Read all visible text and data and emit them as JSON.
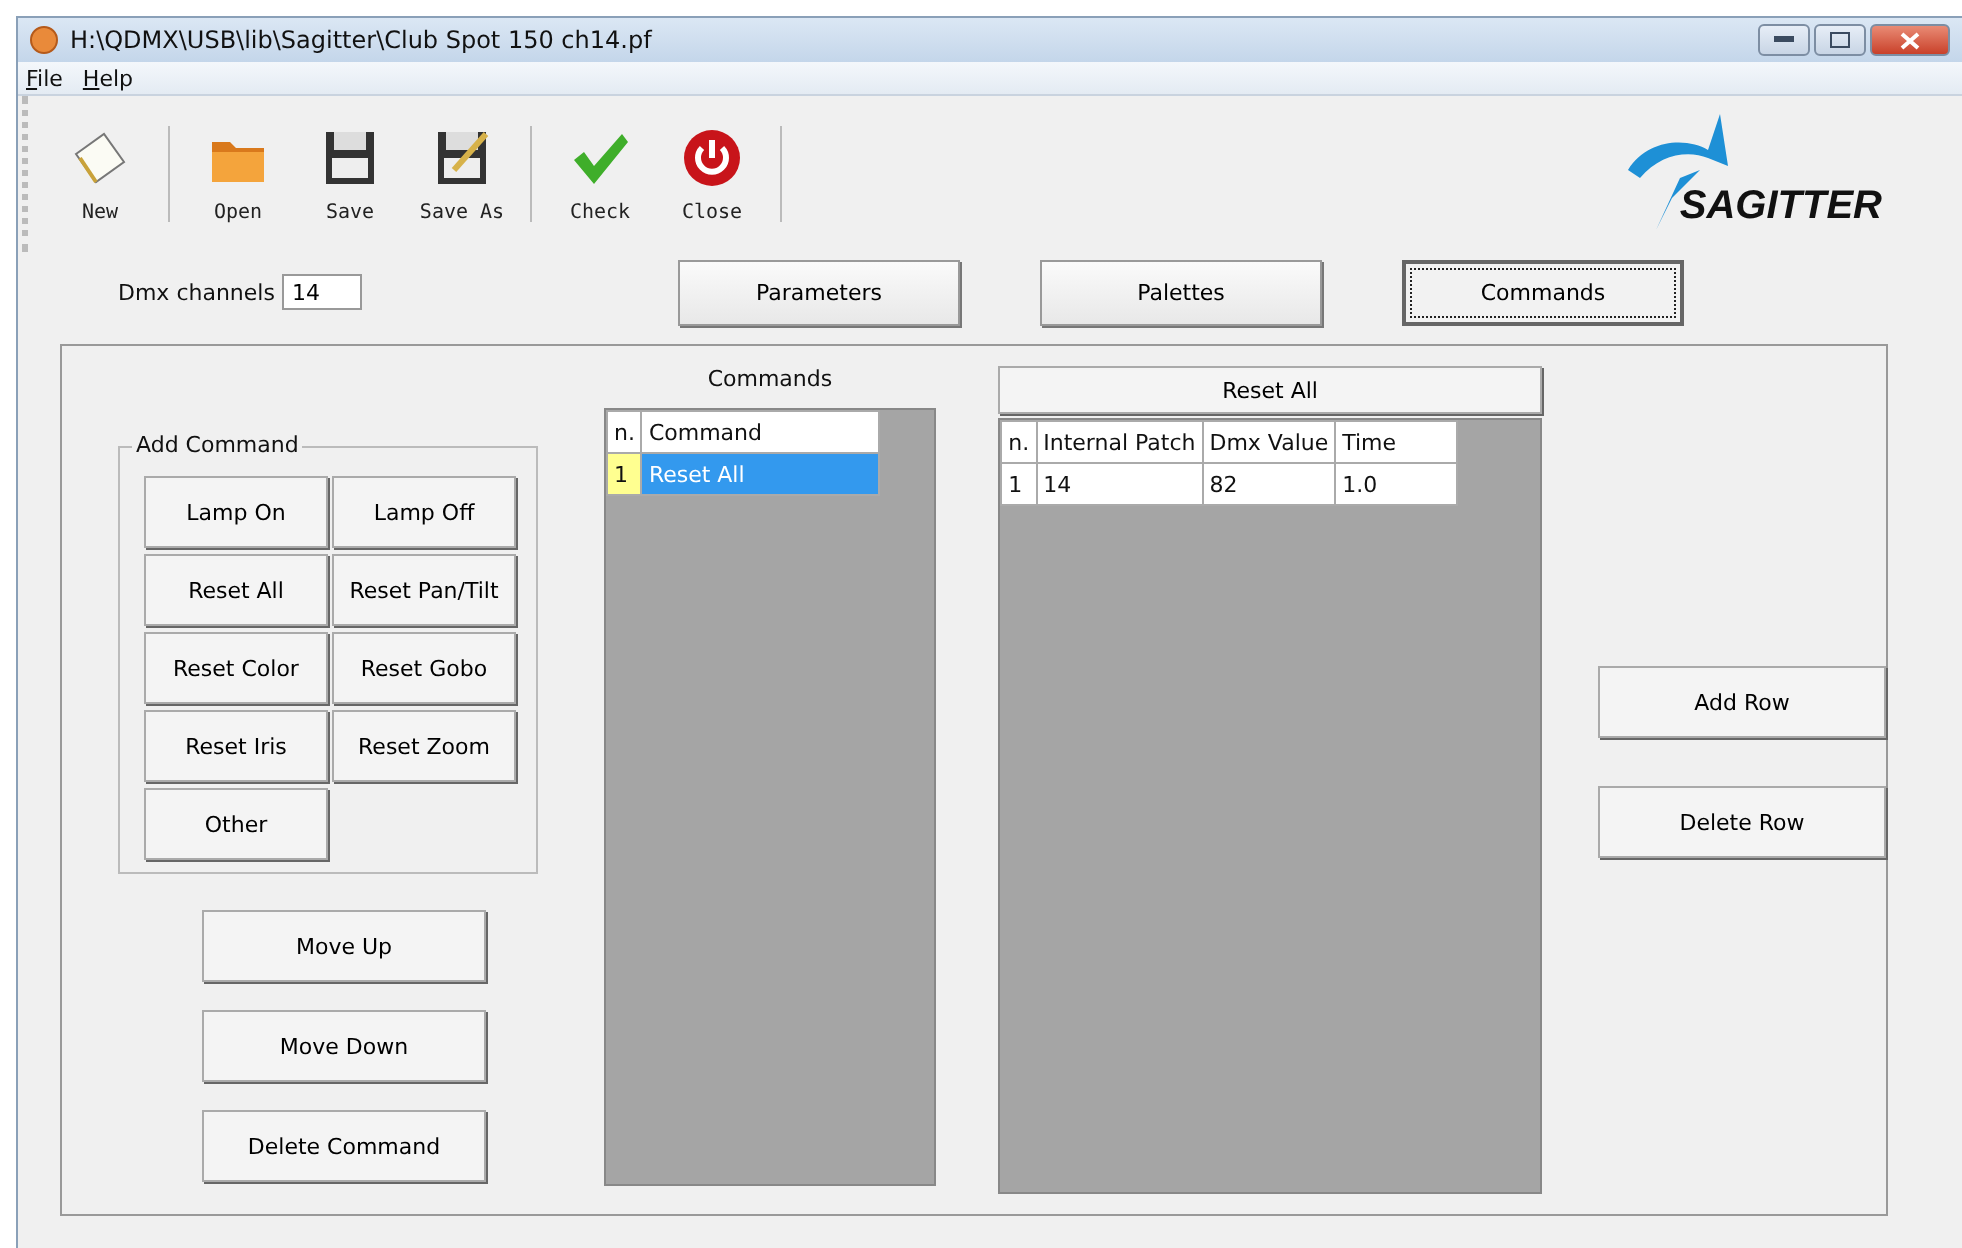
{
  "window": {
    "title": "H:\\QDMX\\USB\\lib\\Sagitter\\Club Spot 150 ch14.pf"
  },
  "menu": [
    "File",
    "Help"
  ],
  "toolbar": [
    {
      "label": "New"
    },
    {
      "label": "Open"
    },
    {
      "label": "Save"
    },
    {
      "label": "Save As"
    },
    {
      "label": "Check"
    },
    {
      "label": "Close"
    }
  ],
  "logo": {
    "text": "SAGITTER"
  },
  "dmx_channels": {
    "label": "Dmx channels",
    "value": "14"
  },
  "tabs": [
    {
      "label": "Parameters",
      "selected": false
    },
    {
      "label": "Palettes",
      "selected": false
    },
    {
      "label": "Commands",
      "selected": true
    }
  ],
  "add_command": {
    "title": "Add Command",
    "buttons": [
      "Lamp On",
      "Lamp Off",
      "Reset All",
      "Reset Pan/Tilt",
      "Reset Color",
      "Reset Gobo",
      "Reset Iris",
      "Reset Zoom",
      "Other"
    ]
  },
  "move_buttons": [
    "Move Up",
    "Move Down",
    "Delete Command"
  ],
  "commands_list": {
    "title": "Commands",
    "columns": [
      "n.",
      "Command"
    ],
    "rows": [
      {
        "n": "1",
        "command": "Reset All",
        "selected": true
      }
    ]
  },
  "detail_table": {
    "title": "Reset All",
    "columns": [
      "n.",
      "Internal Patch",
      "Dmx Value",
      "Time"
    ],
    "rows": [
      [
        "1",
        "14",
        "82",
        "1.0"
      ]
    ]
  },
  "row_buttons": [
    "Add Row",
    "Delete Row"
  ]
}
